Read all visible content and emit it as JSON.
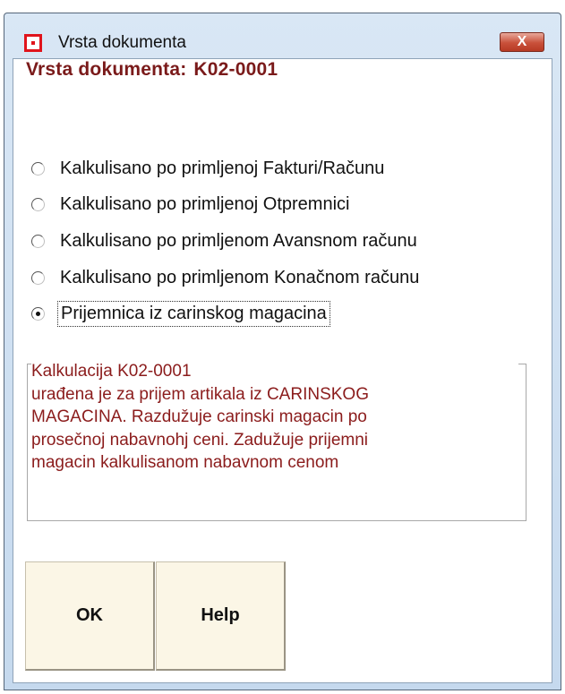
{
  "window": {
    "title": "Vrsta dokumenta",
    "icon": "app-icon",
    "close_label": "X"
  },
  "heading": {
    "label": "Vrsta dokumenta:",
    "code": "K02-0001"
  },
  "options": [
    {
      "label": "Kalkulisano po primljenoj Fakturi/Računu",
      "checked": false
    },
    {
      "label": "Kalkulisano po primljenoj Otpremnici",
      "checked": false
    },
    {
      "label": "Kalkulisano po primljenom Avansnom računu",
      "checked": false
    },
    {
      "label": "Kalkulisano po primljenom Konačnom računu",
      "checked": false
    },
    {
      "label": "Prijemnica iz carinskog magacina",
      "checked": true
    }
  ],
  "info": {
    "lines": [
      "Kalkulacija K02-0001",
      "urađena je za prijem artikala iz CARINSKOG",
      "MAGACINA. Razdužuje carinski magacin po",
      "prosečnoj nabavnohj ceni. Zadužuje prijemni",
      "magacin kalkulisanom nabavnom cenom"
    ]
  },
  "buttons": {
    "ok_label": "OK",
    "help_label": "Help"
  },
  "colors": {
    "heading": "#7a1a1a",
    "info_text": "#8b1c1c",
    "button_bg": "#fbf6e6",
    "close_button": "#c9503a"
  }
}
